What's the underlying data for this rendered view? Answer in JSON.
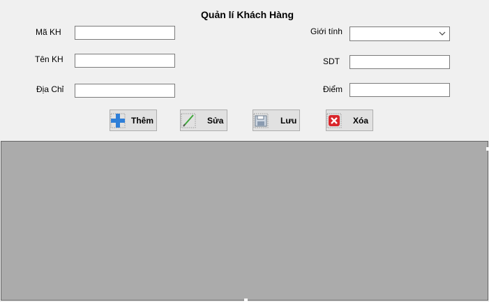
{
  "form": {
    "title": "Quản lí Khách Hàng"
  },
  "fields": {
    "ma_kh": {
      "label": "Mã KH",
      "value": ""
    },
    "ten_kh": {
      "label": "Tên KH",
      "value": ""
    },
    "dia_chi": {
      "label": "Địa Chỉ",
      "value": ""
    },
    "gioi_tinh": {
      "label": "Giới tính",
      "value": ""
    },
    "sdt": {
      "label": "SDT",
      "value": ""
    },
    "diem": {
      "label": "Điểm",
      "value": ""
    }
  },
  "buttons": {
    "them": {
      "label": "Thêm",
      "icon": "plus-icon"
    },
    "sua": {
      "label": "Sửa",
      "icon": "pencil-icon"
    },
    "luu": {
      "label": "Lưu",
      "icon": "floppy-disk-icon"
    },
    "xoa": {
      "label": "Xóa",
      "icon": "delete-x-icon"
    }
  },
  "grid": {
    "rows": []
  },
  "colors": {
    "form_background": "#f0f0f0",
    "grid_background": "#ababab",
    "button_background": "#e1e1e1",
    "plus_blue": "#2f7fd8",
    "delete_red": "#d9262b"
  }
}
